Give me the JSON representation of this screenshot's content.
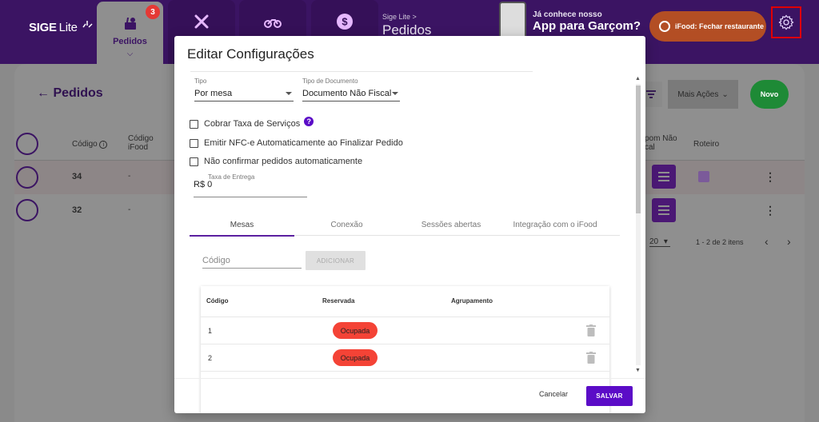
{
  "topbar": {
    "logo": {
      "brand": "SIGE",
      "suffix": "Lite"
    },
    "tabs": [
      {
        "label": "Pedidos",
        "badge": "3",
        "icon": "food-icon",
        "active": true
      },
      {
        "label": "",
        "icon": "utensils-icon"
      },
      {
        "label": "",
        "icon": "motorcycle-icon"
      },
      {
        "label": "",
        "icon": "dollar-icon"
      }
    ],
    "breadcrumb": {
      "app": "Sige Lite",
      "separator": ">",
      "current": "Pedidos"
    },
    "promo": {
      "line1": "Já conhece nosso",
      "line2": "App para Garçom?"
    },
    "ifood_button": "iFood: Fechar restaurante",
    "settings_icon": "gear-icon"
  },
  "background_page": {
    "title": "Pedidos",
    "more_actions": "Mais Ações",
    "new_button": "Novo",
    "columns": {
      "codigo": "Código",
      "codigo_ifood": "Código iFood",
      "cupom": "Cupom Não Fiscal",
      "cupom_visible": "pom Não cal",
      "roteiro": "Roteiro"
    },
    "rows": [
      {
        "codigo": "34",
        "ifood": "-"
      },
      {
        "codigo": "32",
        "ifood": "-"
      }
    ],
    "page_size": "20",
    "range": "1 - 2 de 2 itens"
  },
  "modal": {
    "title": "Editar Configurações",
    "tipo": {
      "label": "Tipo",
      "value": "Por mesa"
    },
    "tipo_documento": {
      "label": "Tipo de Documento",
      "value": "Documento Não Fiscal"
    },
    "checkboxes": [
      {
        "label": "Cobrar Taxa de Serviços",
        "checked": false,
        "help": true
      },
      {
        "label": "Emitir NFC-e Automaticamente ao Finalizar Pedido",
        "checked": false
      },
      {
        "label": "Não confirmar pedidos automaticamente",
        "checked": false
      }
    ],
    "taxa_entrega": {
      "label": "Taxa de Entrega",
      "value": "R$ 0"
    },
    "tabs": [
      "Mesas",
      "Conexão",
      "Sessões abertas",
      "Integração com o iFood"
    ],
    "active_tab": "Mesas",
    "code_input": {
      "placeholder": "Código",
      "value": ""
    },
    "add_button": "ADICIONAR",
    "table": {
      "headers": [
        "Código",
        "Reservada",
        "Agrupamento"
      ],
      "rows": [
        {
          "codigo": "1",
          "status": "Ocupada",
          "agrupamento": ""
        },
        {
          "codigo": "2",
          "status": "Ocupada",
          "agrupamento": ""
        }
      ]
    },
    "cancel": "Cancelar",
    "save": "SALVAR"
  },
  "colors": {
    "primary": "#5b0cc7",
    "header": "#3b1463",
    "occupied": "#f44336",
    "ifood": "#b34e24",
    "novo": "#1e8a36"
  }
}
